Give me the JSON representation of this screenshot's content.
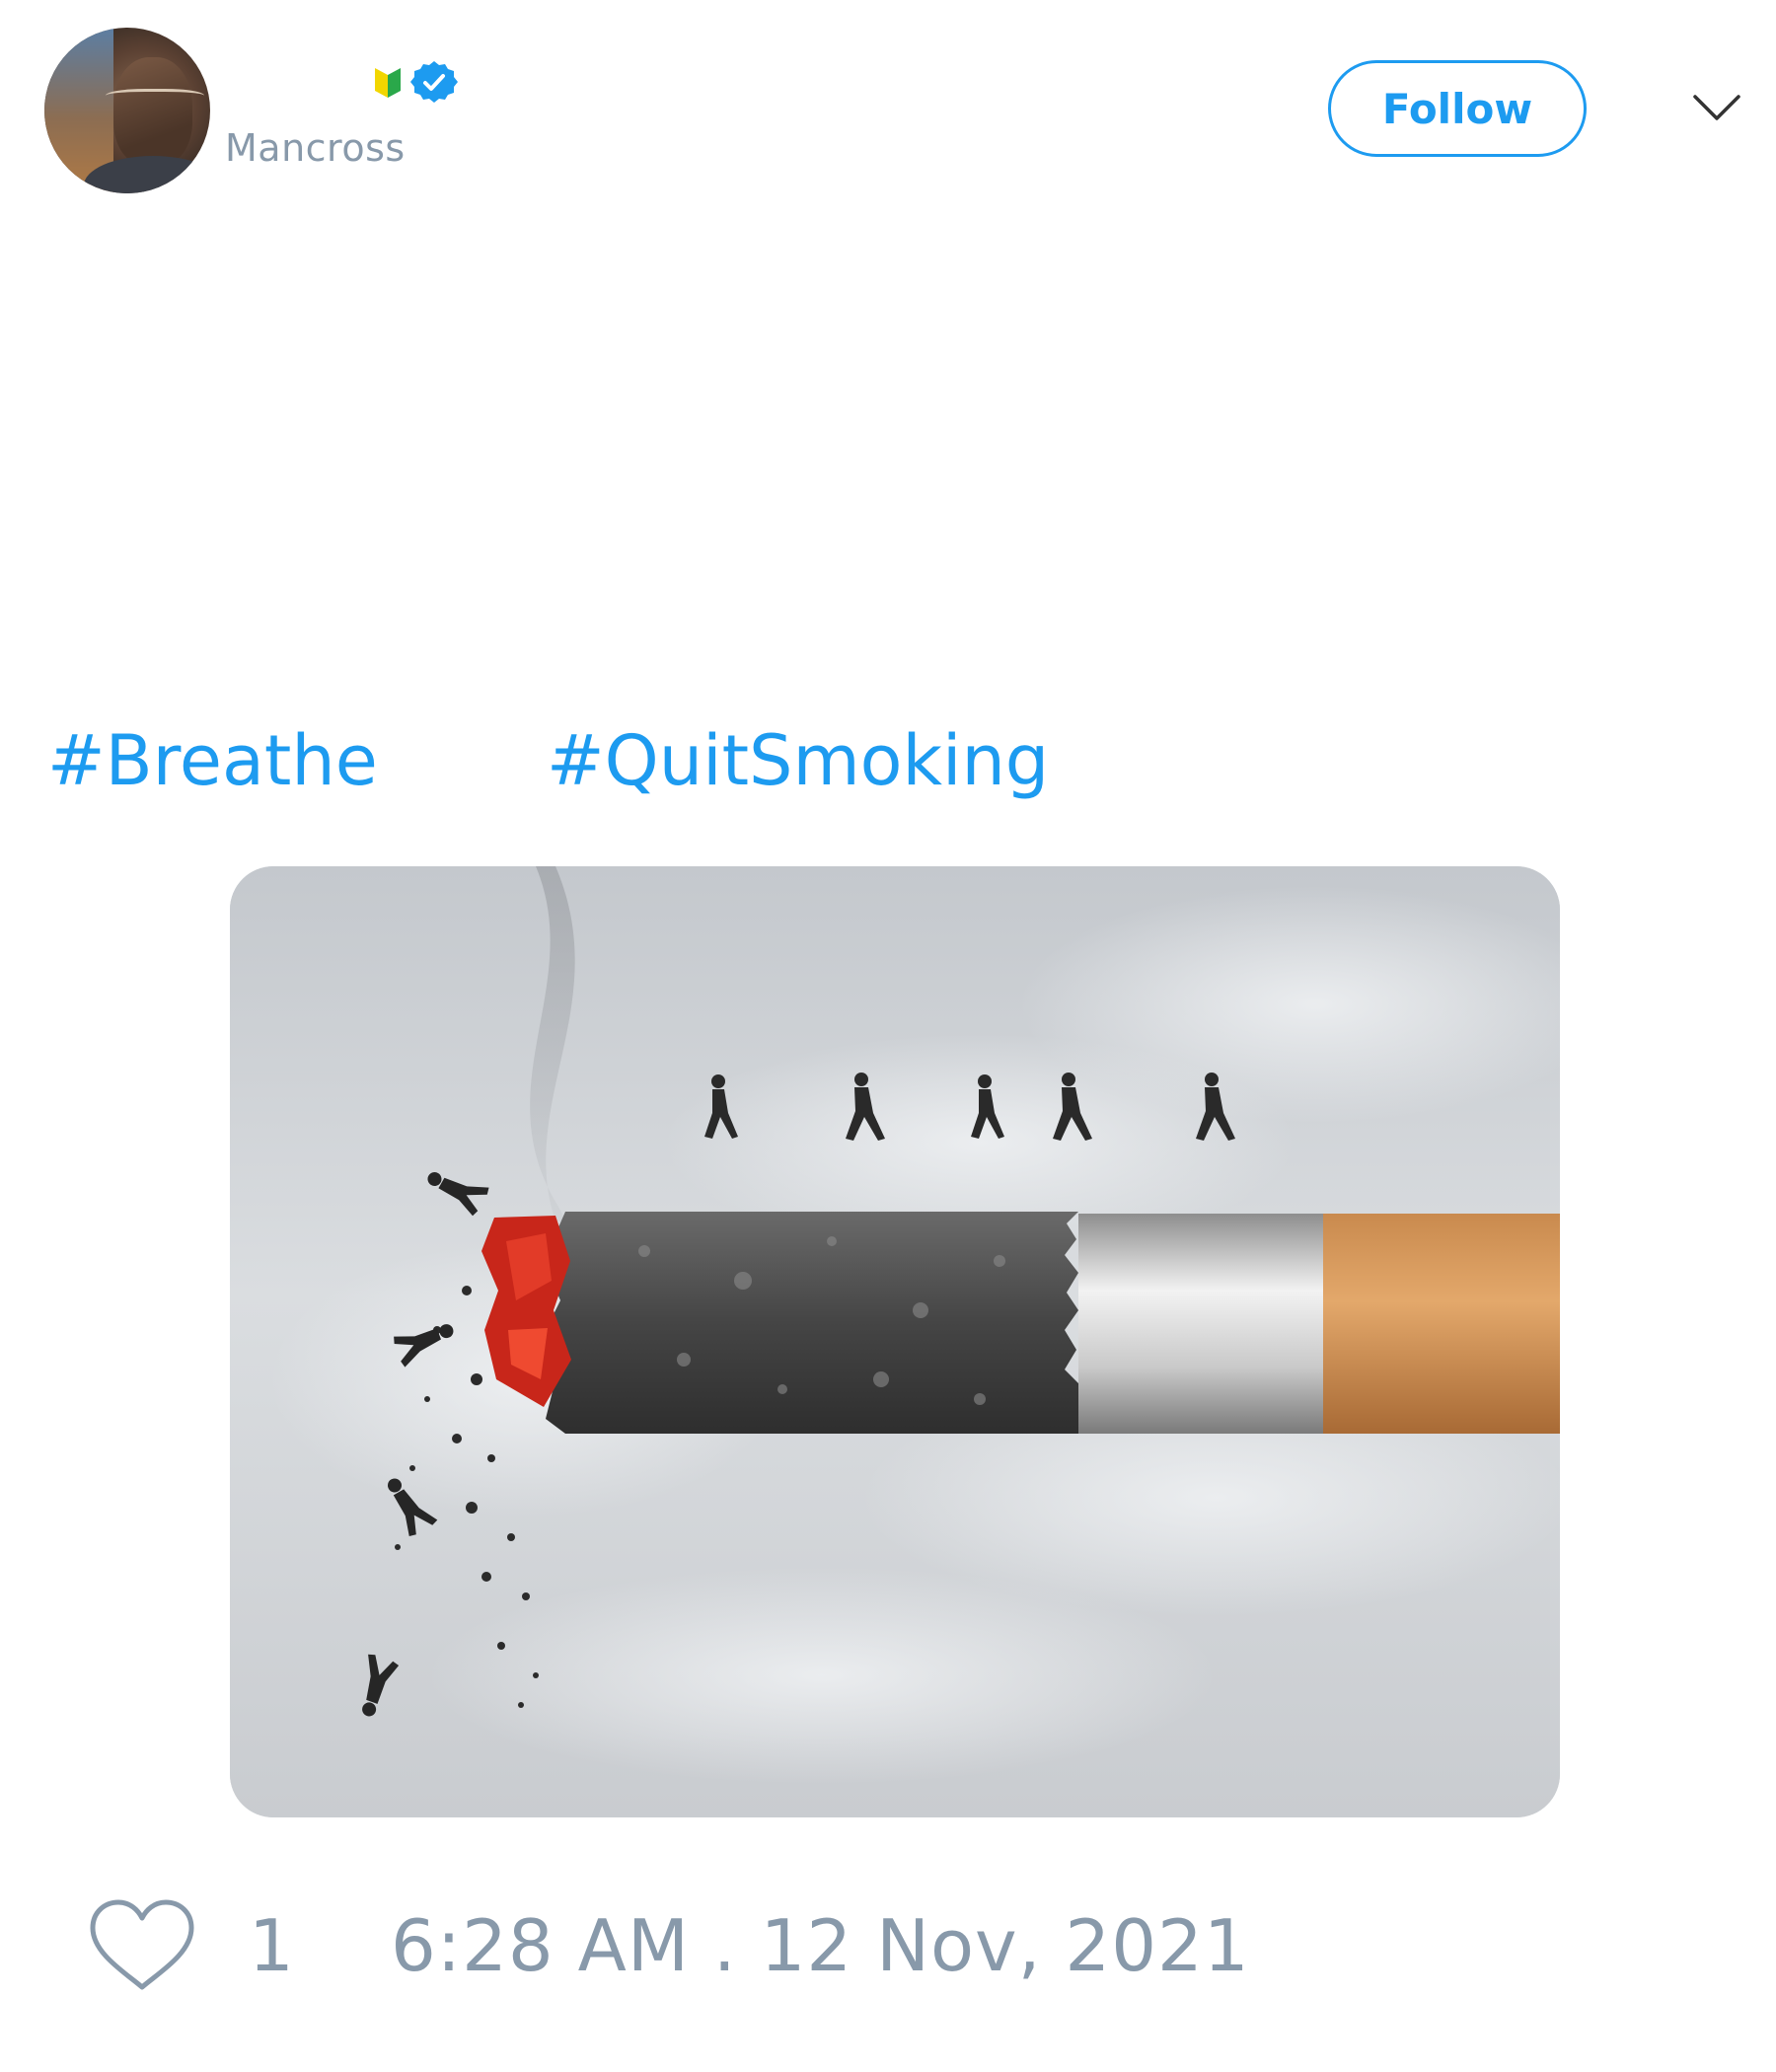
{
  "tweet": {
    "author": {
      "handle": "Mancross",
      "avatar_icon": "profile-photo",
      "badges": [
        "beginner-icon",
        "verified-icon"
      ]
    },
    "follow_label": "Follow",
    "menu_icon": "chevron-down-icon",
    "hashtags": [
      "#Breathe",
      "#QuitSmoking"
    ],
    "media": {
      "alt_subject": "cigarette-illustration"
    },
    "likes": {
      "icon": "heart-icon",
      "count": "1"
    },
    "timestamp": "6:28 AM . 12 Nov, 2021"
  },
  "colors": {
    "accent": "#1d9bf0",
    "muted_text": "#8899aa",
    "background": "#ffffff"
  }
}
